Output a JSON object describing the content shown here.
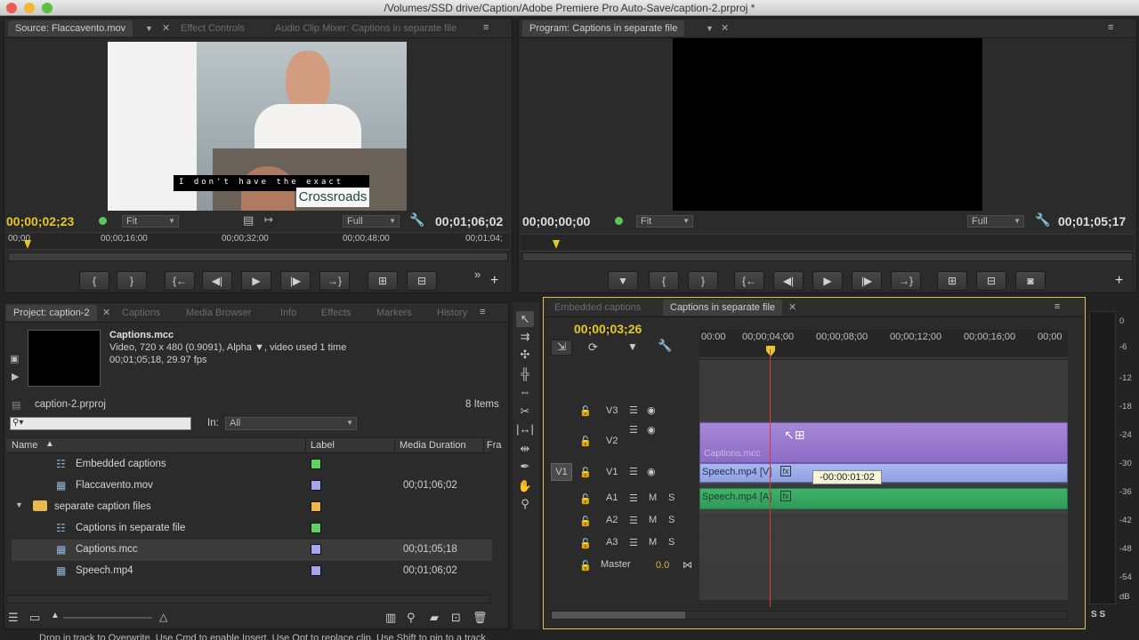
{
  "window": {
    "title": "/Volumes/SSD drive/Caption/Adobe Premiere Pro Auto-Save/caption-2.prproj *"
  },
  "source": {
    "tabs": [
      "Source: Flaccavento.mov",
      "Effect Controls",
      "Audio Clip Mixer: Captions in separate file"
    ],
    "overlay_caption": "I don't have the exact",
    "overlay_sign": "Crossroads",
    "timecode": "00;00;02;23",
    "fit": "Fit",
    "quality": "Full",
    "duration": "00;01;06;02",
    "ruler": [
      "00;00",
      "00;00;16;00",
      "00;00;32;00",
      "00;00;48;00",
      "00;01;04;"
    ]
  },
  "program": {
    "tab": "Program: Captions in separate file",
    "timecode": "00;00;00;00",
    "fit": "Fit",
    "quality": "Full",
    "duration": "00;01;05;17"
  },
  "project": {
    "tabs": [
      "Project: caption-2",
      "Captions",
      "Media Browser",
      "Info",
      "Effects",
      "Markers",
      "History"
    ],
    "clip_name": "Captions.mcc",
    "clip_line1": "Video, 720 x 480 (0.9091), Alpha",
    "clip_line1_b": ", video used 1 time",
    "clip_line2": "00;01;05;18, 29.97 fps",
    "project_file": "caption-2.prproj",
    "item_count": "8 Items",
    "in_label": "In:",
    "in_value": "All",
    "columns": [
      "Name",
      "Label",
      "Media Duration",
      "Fra"
    ],
    "rows": [
      {
        "name": "Embedded captions",
        "duration": "",
        "color": "#5fd35f",
        "icon": "sequence-icon"
      },
      {
        "name": "Flaccavento.mov",
        "duration": "00;01;06;02",
        "color": "#a6a6f0",
        "icon": "film-icon"
      },
      {
        "name": "separate caption files",
        "duration": "",
        "color": "#f2b54a",
        "icon": "folder-icon"
      },
      {
        "name": "Captions in separate file",
        "duration": "",
        "color": "#5fd35f",
        "icon": "sequence-icon"
      },
      {
        "name": "Captions.mcc",
        "duration": "00;01;05;18",
        "color": "#a6a6f0",
        "icon": "film-icon"
      },
      {
        "name": "Speech.mp4",
        "duration": "00;01;06;02",
        "color": "#a6a6f0",
        "icon": "film-icon"
      }
    ]
  },
  "timeline": {
    "tabs": [
      "Embedded captions",
      "Captions in separate file"
    ],
    "timecode": "00;00;03;26",
    "ruler": [
      "00:00",
      "00;00;04;00",
      "00;00;08;00",
      "00;00;12;00",
      "00;00;16;00",
      "00;00"
    ],
    "tracks": {
      "v3": "V3",
      "v2": "V2",
      "v1": "V1",
      "v1_src": "V1",
      "a1": "A1",
      "a2": "A2",
      "a3": "A3",
      "master": "Master",
      "master_val": "0.0",
      "m": "M",
      "s": "S"
    },
    "clips": {
      "captions": "Captions.mcc",
      "speech_v": "Speech.mp4 [V]",
      "speech_a": "Speech.mp4 [A]"
    },
    "drag_tooltip": "-00:00:01:02"
  },
  "meter_labels": [
    "0",
    "-6",
    "-12",
    "-18",
    "-24",
    "-30",
    "-36",
    "-42",
    "-48",
    "-54",
    "dB"
  ],
  "meter_solo": "S S",
  "status": "Drop in track to Overwrite. Use Cmd to enable Insert. Use Opt to replace clip. Use Shift to pin to a track."
}
